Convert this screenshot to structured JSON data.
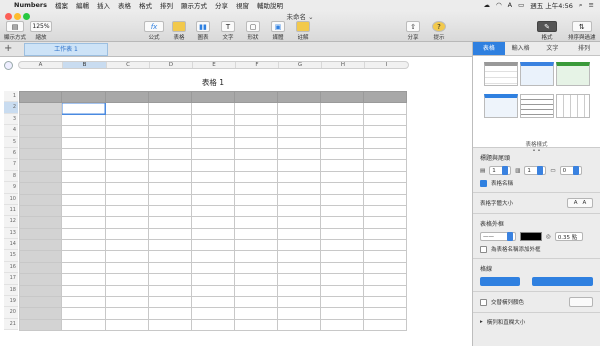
{
  "menubar": {
    "apple": "",
    "app": "Numbers",
    "items": [
      "檔案",
      "編輯",
      "插入",
      "表格",
      "格式",
      "排列",
      "顯示方式",
      "分享",
      "視窗",
      "輔助說明"
    ],
    "status": "A",
    "datetime": "週五 上午4:56"
  },
  "window": {
    "title": "未命名",
    "chevron": "⌄"
  },
  "toolbar": {
    "view": {
      "label": "顯示方式"
    },
    "zoom": {
      "value": "125%",
      "label": "縮放"
    },
    "formula": {
      "label": "公式",
      "icon": "fx"
    },
    "table": {
      "label": "表格"
    },
    "chart": {
      "label": "圖表"
    },
    "text": {
      "label": "文字",
      "icon": "T"
    },
    "shape": {
      "label": "形狀"
    },
    "media": {
      "label": "媒體"
    },
    "comment": {
      "label": "註解"
    },
    "share": {
      "label": "分享"
    },
    "tips": {
      "label": "提示",
      "icon": "?"
    },
    "format": {
      "label": "格式"
    },
    "sort": {
      "label": "排序與過濾"
    }
  },
  "sheet": {
    "add": "+",
    "tab": "工作表 1"
  },
  "columns": [
    "A",
    "B",
    "C",
    "D",
    "E",
    "F",
    "G",
    "H",
    "I"
  ],
  "table": {
    "title": "表格 1",
    "rows": [
      "1",
      "2",
      "3",
      "4",
      "5",
      "6",
      "7",
      "8",
      "9",
      "10",
      "11",
      "12",
      "13",
      "14",
      "15",
      "16",
      "17",
      "18",
      "19",
      "20",
      "21"
    ]
  },
  "panel": {
    "tabs": [
      "表格",
      "輸入格",
      "文字",
      "排列"
    ],
    "styles_label": "表格樣式",
    "headers": {
      "title": "標題與尾頭",
      "h1": "1",
      "h2": "1",
      "footer": "0",
      "show_name": "表格名稱"
    },
    "font": {
      "title": "表格字體大小",
      "small": "A",
      "big": "A"
    },
    "outline": {
      "title": "表格外框",
      "width": "0.35 點",
      "show_name_outline": "為表格名稱添加外框"
    },
    "grid": {
      "title": "格線"
    },
    "alt": {
      "title": "交替橫列顏色"
    },
    "rowcol": {
      "title": "橫列和直欄大小"
    }
  },
  "colors": {
    "accent": "#2f80e0",
    "header": "#a8a8a8",
    "headercol": "#d3d3d3"
  }
}
